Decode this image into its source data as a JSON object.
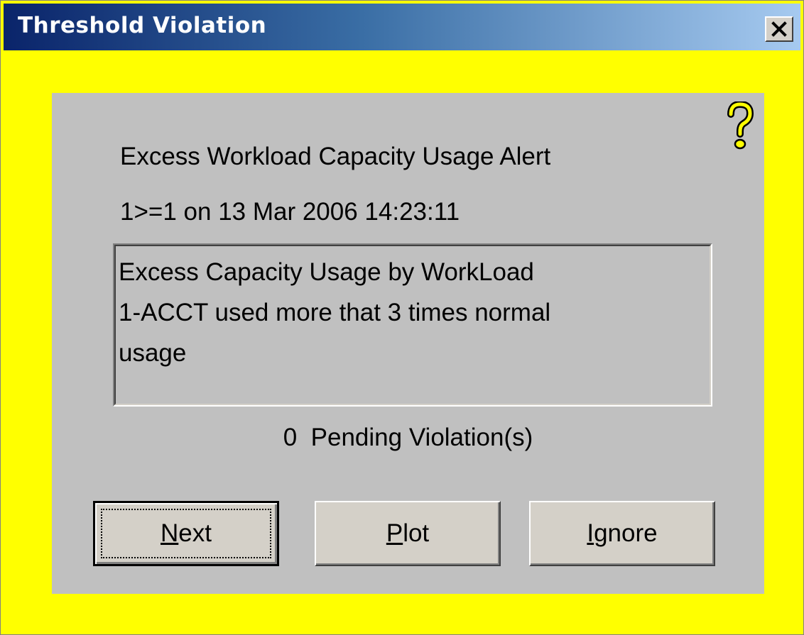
{
  "window": {
    "title": "Threshold Violation",
    "close_label": "X"
  },
  "alert": {
    "title": "Excess Workload Capacity Usage Alert",
    "timestamp": "1>=1 on 13 Mar 2006 14:23:11",
    "message_lines": [
      "Excess Capacity Usage by WorkLoad",
      "1-ACCT used more that 3 times normal",
      "usage"
    ],
    "pending_count": "0",
    "pending_label": "Pending Violation(s)"
  },
  "buttons": {
    "next": {
      "mnemonic": "N",
      "rest": "ext"
    },
    "plot": {
      "mnemonic": "P",
      "rest": "lot"
    },
    "ignore": {
      "mnemonic": "I",
      "rest": "gnore"
    }
  },
  "colors": {
    "background": "#ffff00",
    "panel": "#c0c0c0",
    "titlebar_start": "#0a246a",
    "titlebar_end": "#a6caf0",
    "help_icon": "#ffff00"
  },
  "icons": {
    "help": "question-mark-icon",
    "close": "close-icon"
  }
}
